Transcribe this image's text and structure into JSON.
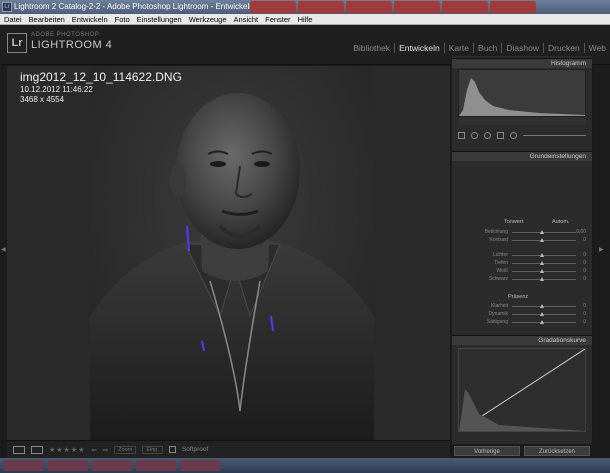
{
  "window": {
    "title": "Lightroom 2 Catalog-2-2 - Adobe Photoshop Lightroom - Entwickeln"
  },
  "menu": [
    "Datei",
    "Bearbeiten",
    "Entwickeln",
    "Foto",
    "Einstellungen",
    "Werkzeuge",
    "Ansicht",
    "Fenster",
    "Hilfe"
  ],
  "brand": {
    "logo": "Lr",
    "sub": "ADOBE PHOTOSHOP",
    "name": "LIGHTROOM 4"
  },
  "modules": [
    "Bibliothek",
    "Entwickeln",
    "Karte",
    "Buch",
    "Diashow",
    "Drucken",
    "Web"
  ],
  "active_module": "Entwickeln",
  "image": {
    "filename": "img2012_12_10_114622.DNG",
    "datetime": "10.12.2012 11:46:22",
    "dimensions": "3468 x 4554"
  },
  "panel": {
    "histogram_title": "Histogramm",
    "basic_title": "Grundeinstellungen",
    "curve_title": "Gradationskurve",
    "tonwert": "Tonwert",
    "autom": "Autom.",
    "praesenz": "Präsenz",
    "rows": [
      {
        "label": "Belichtung",
        "value": "0,00"
      },
      {
        "label": "Kontrast",
        "value": "0"
      },
      {
        "label": "Lichter",
        "value": "0"
      },
      {
        "label": "Tiefen",
        "value": "0"
      },
      {
        "label": "Weiß",
        "value": "0"
      },
      {
        "label": "Schwarz",
        "value": "0"
      },
      {
        "label": "Klarheit",
        "value": "0"
      },
      {
        "label": "Dynamik",
        "value": "0"
      },
      {
        "label": "Sättigung",
        "value": "0"
      }
    ]
  },
  "buttons": {
    "previous": "Vorherige",
    "reset": "Zurücksetzen"
  },
  "toolbar": {
    "stars": "★★★★★",
    "zoom": "Zoom",
    "zoom_fit": "Einp.",
    "softproof": "Softproof"
  },
  "colors": {
    "accent": "#e0e0e0",
    "panel_bg": "#2b2b2b"
  }
}
